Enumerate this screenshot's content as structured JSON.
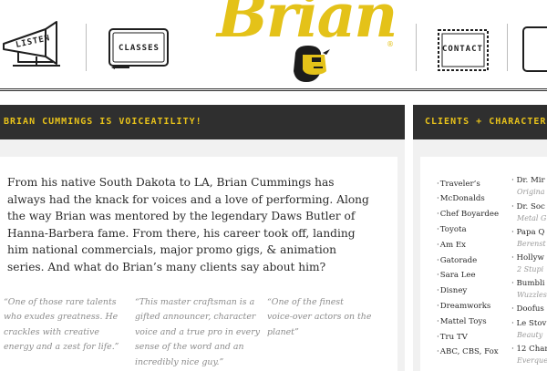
{
  "nav": {
    "listen_label": "LISTEN",
    "classes_label": "CLASSES",
    "contact_label": "CONTACT"
  },
  "logo": {
    "word": "Brian",
    "registered": "®"
  },
  "sections": {
    "main_title": "BRIAN CUMMINGS IS VOICEATILITY!",
    "clients_title": "CLIENTS + CHARACTERS"
  },
  "intro": "From his native South Dakota to LA, Brian Cummings has always had the knack for voices and a love of performing. Along the way Brian was mentored by the legendary Daws Butler of Hanna-Barbera fame. From there, his career took off, landing him national commercials, major promo gigs, & animation series. And what do Brian’s many clients say about him?",
  "quotes": [
    {
      "lines": [
        "“One of those rare talents",
        "who exudes greatness. He",
        "crackles with creative",
        "energy and a zest for life.”"
      ]
    },
    {
      "lines": [
        "“This master craftsman is a",
        "gifted announcer, character",
        "voice and a true pro in every",
        "sense of the word and an",
        "incredibly nice guy.”"
      ]
    },
    {
      "lines": [
        "“One of the finest",
        "voice-over actors on the",
        "planet”"
      ]
    }
  ],
  "clients": [
    "Traveler’s",
    "McDonalds",
    "Chef Boyardee",
    "Toyota",
    "Am Ex",
    "Gatorade",
    "Sara Lee",
    "Disney",
    "Dreamworks",
    "Mattel Toys",
    "Tru TV",
    "ABC, CBS, Fox"
  ],
  "characters": [
    {
      "name": "Dr. Mir",
      "show": "Origina"
    },
    {
      "name": "Dr. Soc",
      "show": "Metal G"
    },
    {
      "name": "Papa Q",
      "show": "Berenst"
    },
    {
      "name": "Hollyw",
      "show": "2 Stupi"
    },
    {
      "name": "Bumbli",
      "show": "Wuzzles"
    },
    {
      "name": "Doofus",
      "show": ""
    },
    {
      "name": "Le Stov",
      "show": "Beauty"
    },
    {
      "name": "12 Char",
      "show": "Everque"
    }
  ],
  "colors": {
    "accent": "#e4c219",
    "bar": "#2f2f2f",
    "bar_text": "#e8c21a",
    "panel_bg": "#f1f1f1",
    "quote_text": "#8c8c8c"
  },
  "icons": [
    "megaphone-icon",
    "chalkboard-icon",
    "stamp-envelope-icon",
    "mascot-head-icon"
  ]
}
